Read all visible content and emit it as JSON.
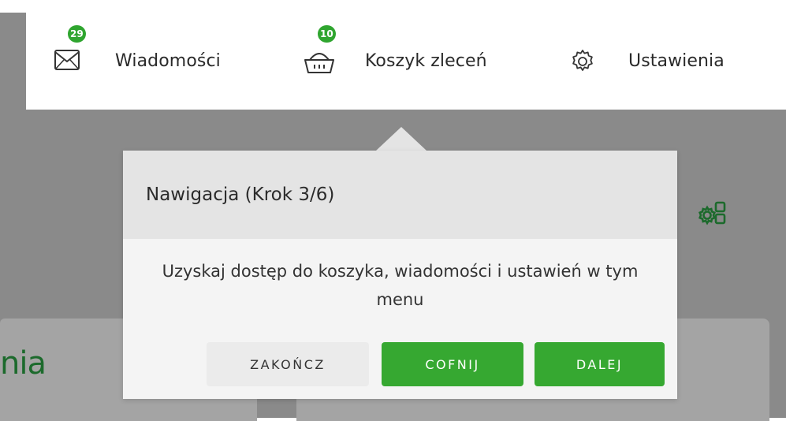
{
  "topmenu": {
    "items": [
      {
        "label": "Wiadomości",
        "badge": "29",
        "icon": "envelope-icon"
      },
      {
        "label": "Koszyk zleceń",
        "badge": "10",
        "icon": "basket-icon"
      },
      {
        "label": "Ustawienia",
        "badge": null,
        "icon": "gear-icon"
      }
    ]
  },
  "background": {
    "partial_heading": "nia"
  },
  "popup": {
    "title": "Nawigacja (Krok 3/6)",
    "body": "Uzyskaj dostęp do koszyka, wiadomości i ustawień w tym menu",
    "buttons": {
      "end": "ZAKOŃCZ",
      "back": "COFNIJ",
      "next": "DALEJ"
    }
  },
  "colors": {
    "accent": "#36a831",
    "badge": "#2fa52f",
    "overlay": "#8a8a8a"
  }
}
